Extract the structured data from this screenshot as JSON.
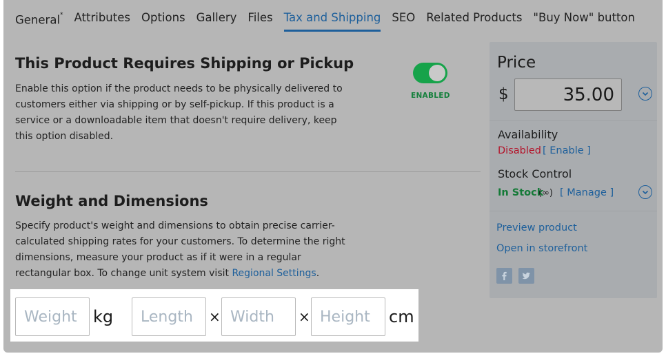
{
  "tabs": [
    {
      "label": "General",
      "marker": "*"
    },
    {
      "label": "Attributes"
    },
    {
      "label": "Options"
    },
    {
      "label": "Gallery"
    },
    {
      "label": "Files"
    },
    {
      "label": "Tax and Shipping",
      "active": true
    },
    {
      "label": "SEO"
    },
    {
      "label": "Related Products"
    },
    {
      "label": "\"Buy Now\" button"
    }
  ],
  "shipping": {
    "title": "This Product Requires Shipping or Pickup",
    "description": "Enable this option if the product needs to be physically delivered to customers either via shipping or by self-pickup. If this product is a service or a downloadable item that doesn't require delivery, keep this option disabled.",
    "toggle_state": "ENABLED"
  },
  "weight": {
    "title": "Weight and Dimensions",
    "description": "Specify product's weight and dimensions to obtain precise carrier-calculated shipping rates for your customers. To determine the right dimensions, measure your product as if it were in a regular rectangular box. To change unit system visit",
    "link": "Regional Settings",
    "period": ".",
    "weight_placeholder": "Weight",
    "weight_unit": "kg",
    "length_placeholder": "Length",
    "width_placeholder": "Width",
    "height_placeholder": "Height",
    "times": "×",
    "dim_unit": "cm"
  },
  "sidebar": {
    "price_title": "Price",
    "currency": "$",
    "price": "35.00",
    "availability_label": "Availability",
    "availability_status": "Disabled",
    "availability_action": "[ Enable ]",
    "stock_label": "Stock Control",
    "stock_status": "In Stock",
    "stock_quantity": "(∞)",
    "stock_action": "[ Manage ]",
    "preview_link": "Preview product",
    "storefront_link": "Open in storefront",
    "social": [
      "facebook-icon",
      "twitter-icon"
    ]
  },
  "colors": {
    "accent": "#1d5f9b",
    "toggle_on": "#16a34a",
    "in_stock": "#157a38",
    "disabled": "#b3132a"
  }
}
